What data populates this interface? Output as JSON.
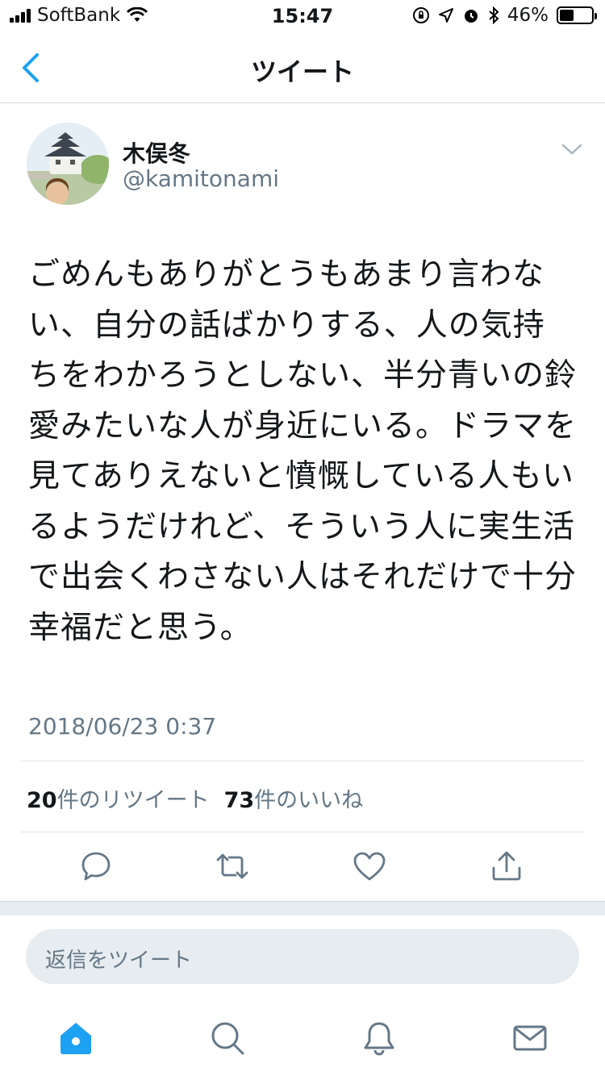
{
  "status_bar": {
    "carrier": "SoftBank",
    "time": "15:47",
    "battery": "46%",
    "battery_level": 0.46
  },
  "nav": {
    "title": "ツイート"
  },
  "tweet": {
    "display_name": "木俣冬",
    "handle": "@kamitonami",
    "text": "ごめんもありがとうもあまり言わない、自分の話ばかりする、人の気持ちをわかろうとしない、半分青いの鈴愛みたいな人が身近にいる。ドラマを見てありえないと憤慨している人もいるようだけれど、そういう人に実生活で出会くわさない人はそれだけで十分幸福だと思う。",
    "timestamp": "2018/06/23 0:37",
    "retweet_count": "20",
    "retweet_label": "件のリツイート",
    "like_count": "73",
    "like_label": "件のいいね"
  },
  "reply": {
    "placeholder": "返信をツイート"
  },
  "colors": {
    "accent": "#1da1f2",
    "muted": "#657786",
    "text": "#14171a",
    "divider": "#e1e8ed"
  },
  "icons": {
    "back": "chevron-left-icon",
    "caret": "chevron-down-icon",
    "reply": "reply-icon",
    "retweet": "retweet-icon",
    "like": "heart-icon",
    "share": "share-icon",
    "home": "home-icon",
    "search": "search-icon",
    "notifications": "bell-icon",
    "messages": "envelope-icon"
  }
}
